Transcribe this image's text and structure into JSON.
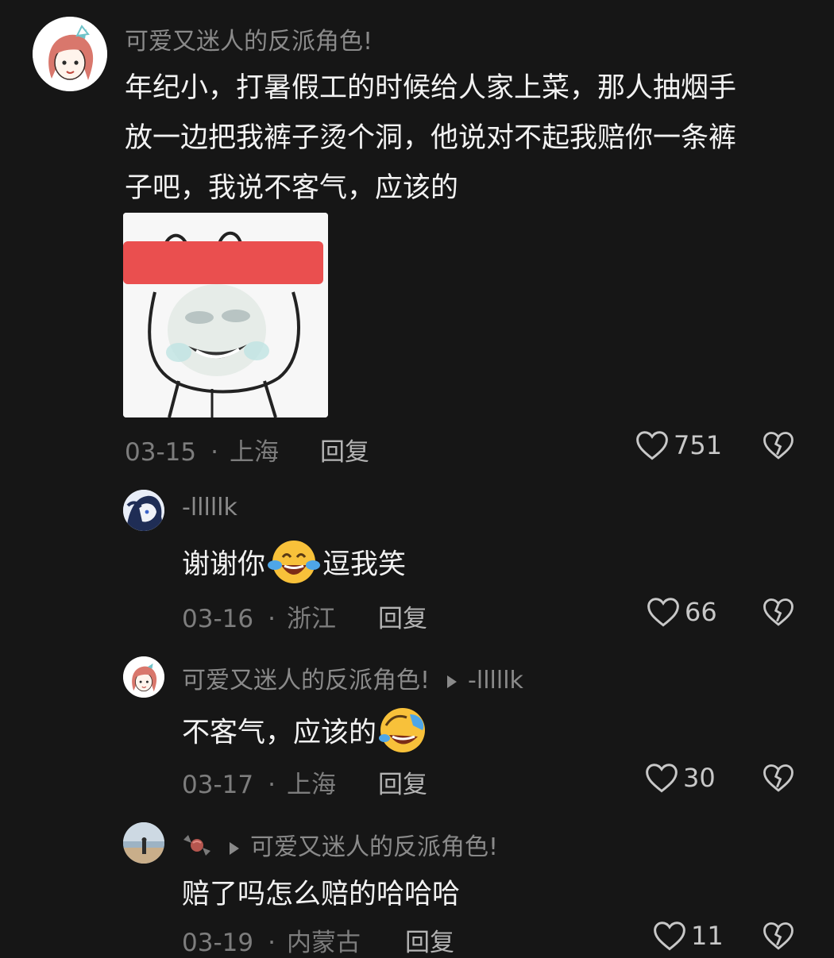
{
  "comments": [
    {
      "username": "可爱又迷人的反派角色!",
      "text_lines": [
        "年纪小，打暑假工的时候给人家上菜，那人抽烟手",
        "放一边把我裤子烫个洞，他说对不起我赔你一条裤",
        "子吧，我说不客气，应该的"
      ],
      "date": "03-15",
      "location": "上海",
      "reply_label": "回复",
      "likes": "751"
    },
    {
      "username": "-lllllk",
      "text_before": "谢谢你",
      "emoji": "crying-laughing-emoji",
      "text_after": "逗我笑",
      "date": "03-16",
      "location": "浙江",
      "reply_label": "回复",
      "likes": "66"
    },
    {
      "username": "可爱又迷人的反派角色!",
      "reply_to": "-lllllk",
      "text_before": "不客气，应该的",
      "emoji": "rolling-laughing-emoji",
      "date": "03-17",
      "location": "上海",
      "reply_label": "回复",
      "likes": "30"
    },
    {
      "username_icon": "candy-icon",
      "reply_to": "可爱又迷人的反派角色!",
      "text": "赔了吗怎么赔的哈哈哈",
      "date": "03-19",
      "location": "内蒙古",
      "reply_label": "回复",
      "likes": "11"
    }
  ],
  "meta_separator": "·",
  "colors": {
    "background": "#161616",
    "username": "#8a8a8a",
    "text": "#f2f2f2",
    "meta": "#7d7d7d",
    "sticker_red": "#ea4f4f"
  }
}
